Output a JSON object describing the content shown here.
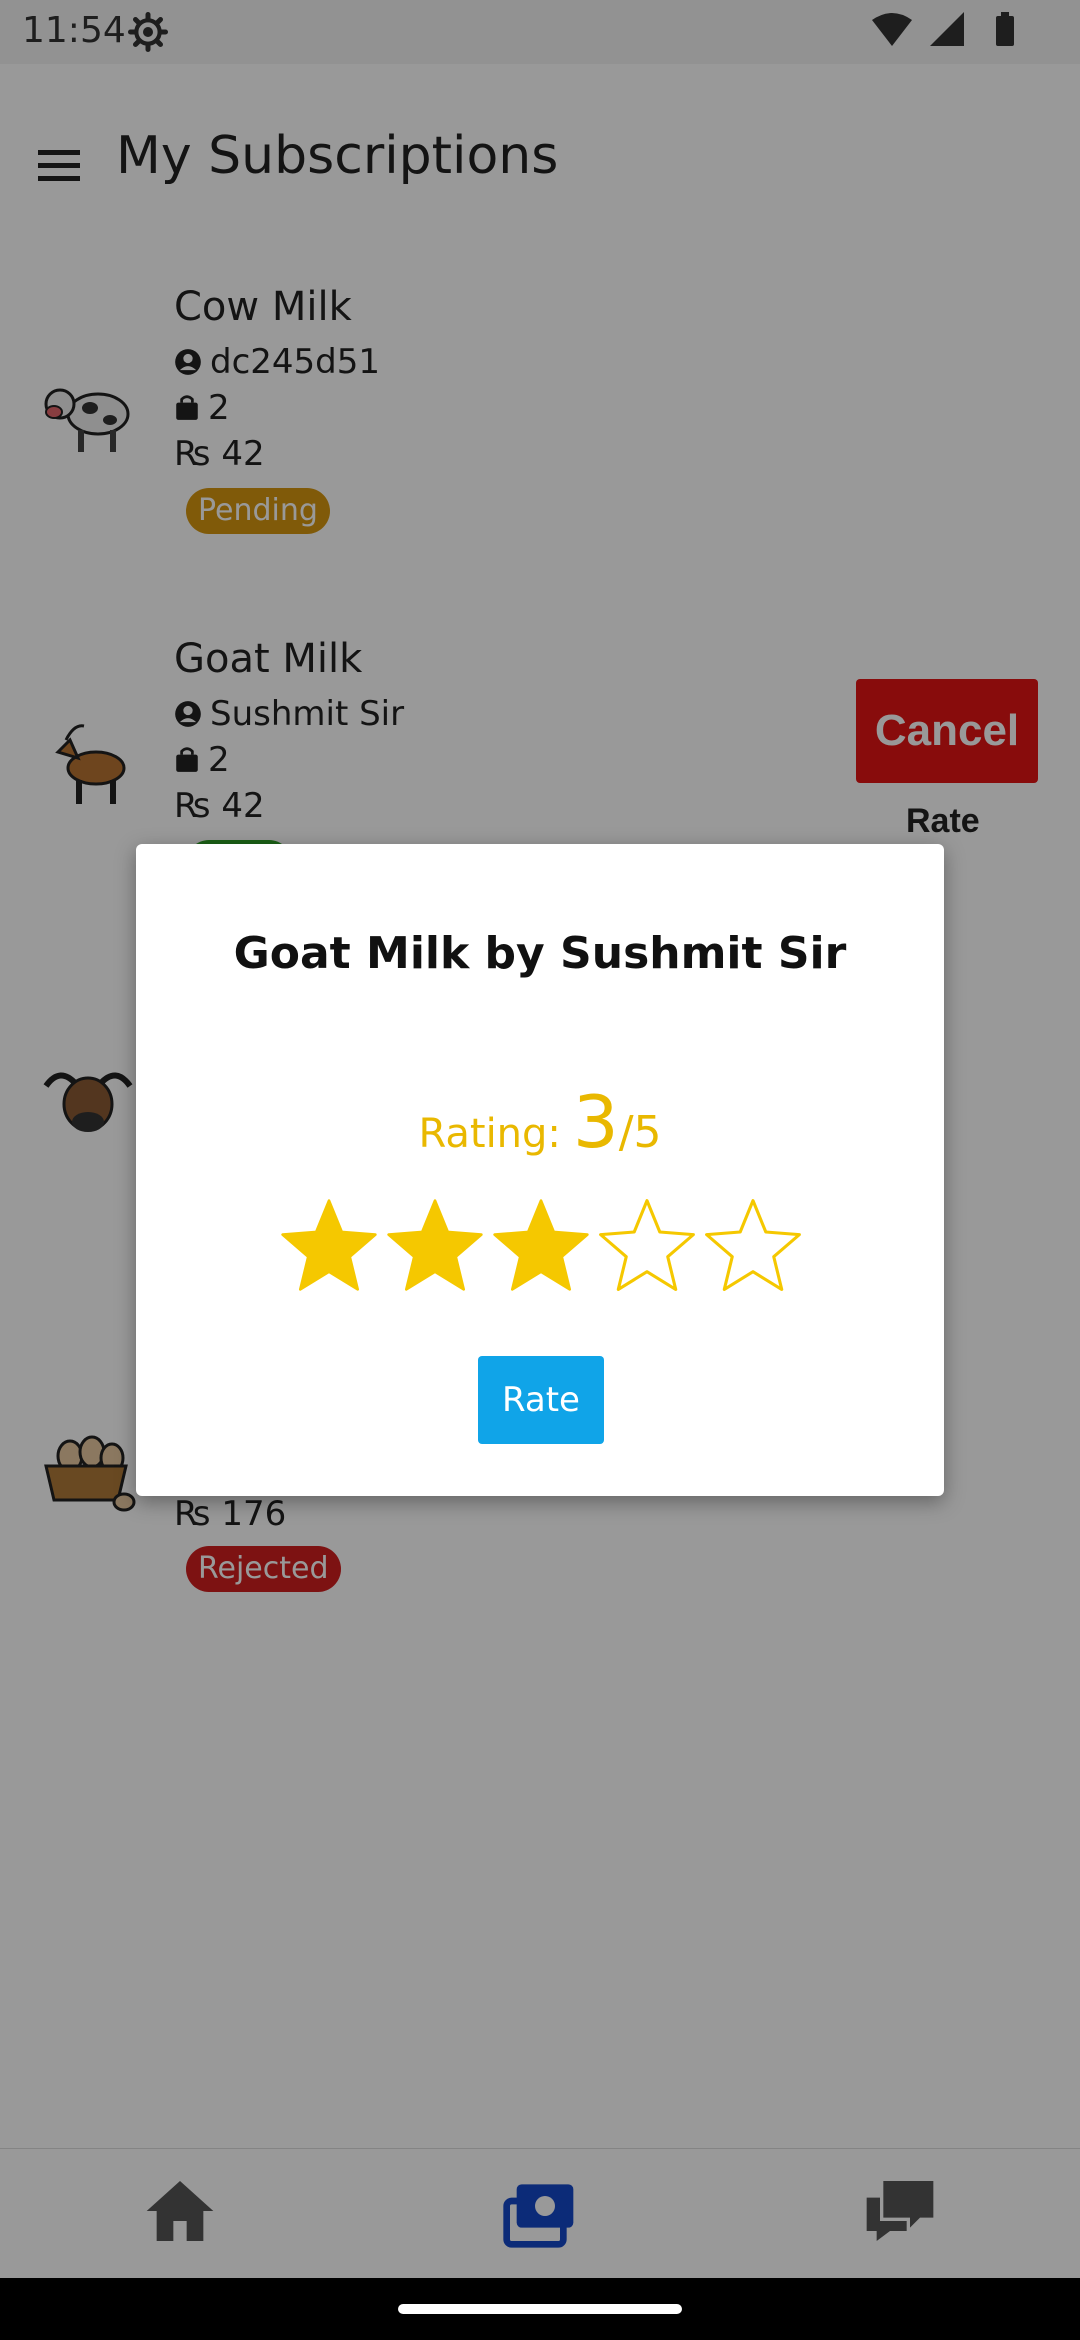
{
  "status_bar": {
    "time": "11:54"
  },
  "app_bar": {
    "title": "My Subscriptions"
  },
  "subscriptions": [
    {
      "title": "Cow Milk",
      "vendor": "dc245d51",
      "quantity": "2",
      "price": "₨ 42",
      "status": "Pending",
      "status_color": "#d6960f",
      "icon": "cow-icon"
    },
    {
      "title": "Goat Milk",
      "vendor": "Sushmit Sir",
      "quantity": "2",
      "price": "₨ 42",
      "status": "",
      "status_color": "#2ea026",
      "icon": "goat-icon"
    },
    {
      "title": "",
      "vendor": "",
      "quantity": "",
      "price": "",
      "status": "",
      "icon": "buffalo-icon"
    },
    {
      "title": "",
      "vendor": "",
      "quantity": "",
      "price": "₨ 176",
      "status": "Rejected",
      "status_color": "#d01e1e",
      "icon": "eggs-basket-icon"
    }
  ],
  "actions": {
    "cancel_label": "Cancel",
    "rate_label": "Rate"
  },
  "dialog": {
    "title": "Goat Milk by Sushmit Sir",
    "rating_label": "Rating:",
    "rating_value": "3",
    "rating_max": "/5",
    "rating": 3,
    "max_stars": 5,
    "button_label": "Rate"
  },
  "bottom_nav": {
    "items": [
      "home-icon",
      "subscriptions-icon",
      "chat-icon"
    ],
    "active": "subscriptions-icon"
  },
  "colors": {
    "star": "#f5c800",
    "rating_text": "#e9b800",
    "accent_blue": "#10a4e8",
    "cancel_red": "#e31515"
  }
}
